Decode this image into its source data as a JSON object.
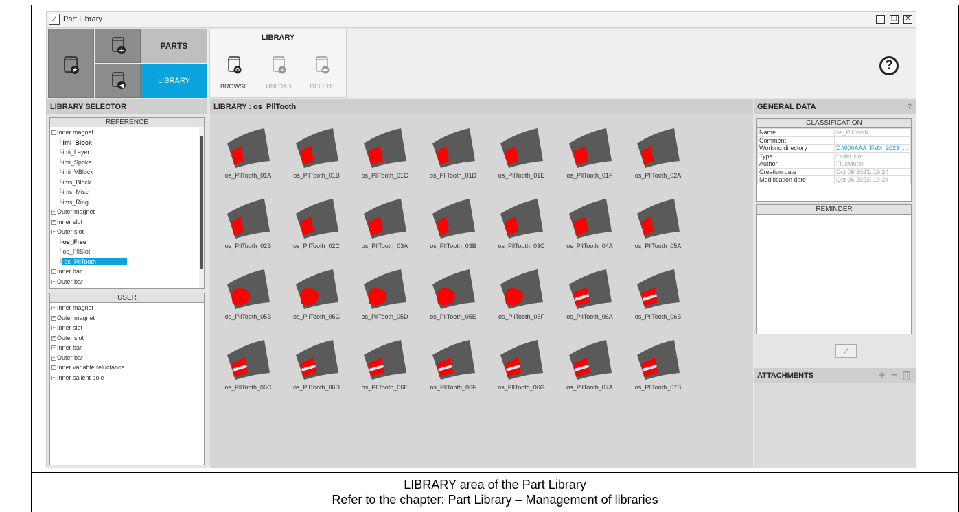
{
  "window": {
    "title": "Part Library",
    "icon": "motor-app-icon"
  },
  "window_controls": {
    "minimize": "–",
    "restore": "❐",
    "close": "✕"
  },
  "ribbon": {
    "parts_tab": "PARTS",
    "library_tab": "LIBRARY",
    "library_group": {
      "title": "LIBRARY",
      "browse": "BROWSE",
      "unload": "UNLOAD",
      "delete": "DELETE"
    },
    "help": "?"
  },
  "library_selector": {
    "header": "LIBRARY SELECTOR",
    "reference": {
      "title": "REFERENCE",
      "items": [
        {
          "label": "Inner magnet",
          "level": 1,
          "exp": "−"
        },
        {
          "label": "imi_Block",
          "level": 2,
          "bold": true
        },
        {
          "label": "imi_Layer",
          "level": 2
        },
        {
          "label": "imi_Spoke",
          "level": 2
        },
        {
          "label": "imi_VBlock",
          "level": 2
        },
        {
          "label": "ims_Block",
          "level": 2
        },
        {
          "label": "ims_Misc",
          "level": 2
        },
        {
          "label": "ims_Ring",
          "level": 2
        },
        {
          "label": "Outer magnet",
          "level": 1,
          "exp": "+"
        },
        {
          "label": "Inner slot",
          "level": 1,
          "exp": "+"
        },
        {
          "label": "Outer slot",
          "level": 1,
          "exp": "−"
        },
        {
          "label": "os_Free",
          "level": 2,
          "bold": true
        },
        {
          "label": "os_PllSlot",
          "level": 2
        },
        {
          "label": "os_PllTooth",
          "level": 2,
          "selected": true
        },
        {
          "label": "Inner bar",
          "level": 1,
          "exp": "+"
        },
        {
          "label": "Outer bar",
          "level": 1,
          "exp": "+"
        }
      ]
    },
    "user": {
      "title": "USER",
      "items": [
        "Inner magnet",
        "Outer magnet",
        "Inner slot",
        "Outer slot",
        "Inner bar",
        "Outer bar",
        "Inner variable reluctance",
        "Inner salient pole"
      ]
    }
  },
  "library": {
    "header": "LIBRARY : os_PllTooth",
    "parts": [
      "os_PllTooth_01A",
      "os_PllTooth_01B",
      "os_PllTooth_01C",
      "os_PllTooth_01D",
      "os_PllTooth_01E",
      "os_PllTooth_01F",
      "os_PllTooth_02A",
      "os_PllTooth_02B",
      "os_PllTooth_02C",
      "os_PllTooth_03A",
      "os_PllTooth_03B",
      "os_PllTooth_03C",
      "os_PllTooth_04A",
      "os_PllTooth_05A",
      "os_PllTooth_05B",
      "os_PllTooth_05C",
      "os_PllTooth_05D",
      "os_PllTooth_05E",
      "os_PllTooth_05F",
      "os_PllTooth_06A",
      "os_PllTooth_06B",
      "os_PllTooth_06C",
      "os_PllTooth_06D",
      "os_PllTooth_06E",
      "os_PllTooth_06F",
      "os_PllTooth_06G",
      "os_PllTooth_07A",
      "os_PllTooth_07B"
    ],
    "colors": {
      "sector": "#5a5a5a",
      "slot": "#ff0000",
      "insert": "#cfe8f5"
    }
  },
  "general_data": {
    "header": "GENERAL DATA",
    "help": "?",
    "classification": {
      "title": "CLASSIFICATION",
      "rows": [
        {
          "key": "Name",
          "value": "os_PllTooth"
        },
        {
          "key": "Comment",
          "value": ""
        },
        {
          "key": "Working directory",
          "value": "D:\\000AAA_FxM_2023_..."
        },
        {
          "key": "Type",
          "value": "Outer slot"
        },
        {
          "key": "Author",
          "value": "FluxMotor"
        },
        {
          "key": "Creation date",
          "value": "Oct 06 2023, 19:24"
        },
        {
          "key": "Modification date",
          "value": "Oct 06 2023, 19:24"
        }
      ]
    },
    "reminder": {
      "title": "REMINDER"
    },
    "validate": "✓"
  },
  "attachments": {
    "header": "ATTACHMENTS",
    "add": "+",
    "remove": "−"
  },
  "caption": {
    "line1": "LIBRARY area of the Part Library",
    "line2": "Refer to the chapter: Part Library – Management of libraries"
  }
}
